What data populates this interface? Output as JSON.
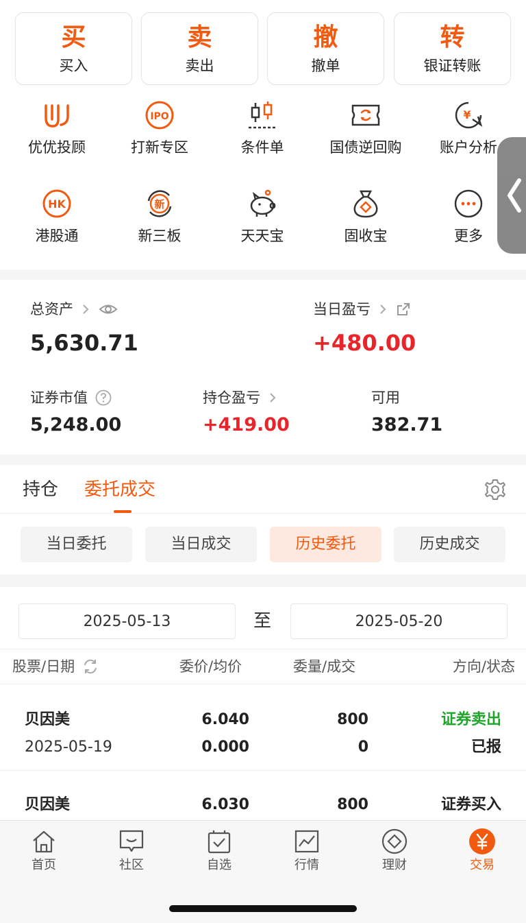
{
  "trade_buttons": [
    {
      "big": "买",
      "small": "买入"
    },
    {
      "big": "卖",
      "small": "卖出"
    },
    {
      "big": "撤",
      "small": "撤单"
    },
    {
      "big": "转",
      "small": "银证转账"
    }
  ],
  "grid": [
    {
      "label": "优优投顾",
      "icon": "uu-advisor-icon"
    },
    {
      "label": "打新专区",
      "icon": "ipo-icon",
      "icon_text": "IPO"
    },
    {
      "label": "条件单",
      "icon": "candlestick-icon"
    },
    {
      "label": "国债逆回购",
      "icon": "bond-repo-icon"
    },
    {
      "label": "账户分析",
      "icon": "account-analysis-icon",
      "icon_text": "¥"
    },
    {
      "label": "港股通",
      "icon": "hk-icon",
      "icon_text": "HK"
    },
    {
      "label": "新三板",
      "icon": "new-third-board-icon",
      "icon_text": "新"
    },
    {
      "label": "天天宝",
      "icon": "piggy-bank-icon"
    },
    {
      "label": "固收宝",
      "icon": "money-bag-icon"
    },
    {
      "label": "更多",
      "icon": "more-icon"
    }
  ],
  "assets": {
    "total_label": "总资产",
    "total_value": "5,630.71",
    "daily_pnl_label": "当日盈亏",
    "daily_pnl_value": "+480.00",
    "market_value_label": "证券市值",
    "market_value": "5,248.00",
    "position_pnl_label": "持仓盈亏",
    "position_pnl_value": "+419.00",
    "available_label": "可用",
    "available_value": "382.71"
  },
  "tabs": {
    "holdings": "持仓",
    "orders": "委托成交"
  },
  "chips": [
    "当日委托",
    "当日成交",
    "历史委托",
    "历史成交"
  ],
  "date_range": {
    "start": "2025-05-13",
    "to": "至",
    "end": "2025-05-20"
  },
  "table": {
    "headers": [
      "股票/日期",
      "委价/均价",
      "委量/成交",
      "方向/状态"
    ],
    "rows": [
      {
        "name": "贝因美",
        "date": "2025-05-19",
        "price": "6.040",
        "avg_price": "0.000",
        "qty": "800",
        "filled": "0",
        "direction": "证券卖出",
        "status": "已报"
      },
      {
        "name": "贝因美",
        "price": "6.030",
        "qty": "800",
        "direction": "证券买入"
      }
    ]
  },
  "nav": [
    "首页",
    "社区",
    "自选",
    "行情",
    "理财",
    "交易"
  ],
  "colors": {
    "accent": "#f15a0f",
    "up": "#e8252b",
    "down": "#1ea52a"
  }
}
